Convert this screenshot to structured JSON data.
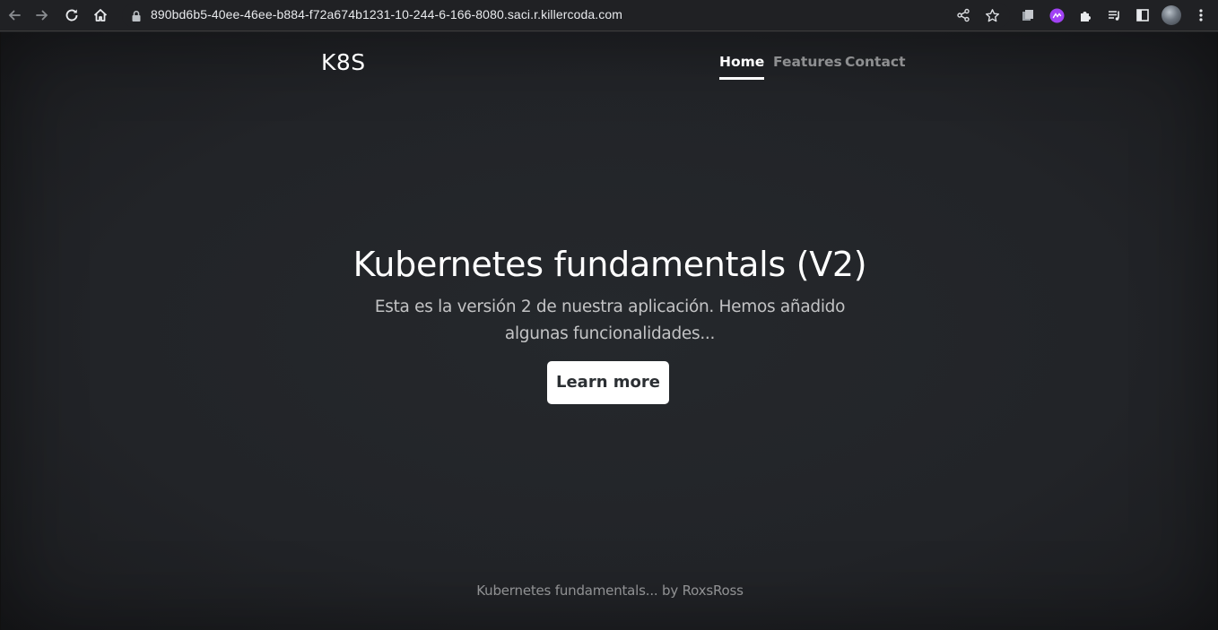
{
  "browser": {
    "url": "890bd6b5-40ee-46ee-b884-f72a674b1231-10-244-6-166-8080.saci.r.killercoda.com",
    "icons": [
      "back-icon",
      "forward-icon",
      "reload-icon",
      "home-icon",
      "lock-icon",
      "share-icon",
      "star-icon",
      "extension-copy-icon",
      "extension-purple-icon",
      "puzzle-icon",
      "media-icon",
      "side-panel-icon",
      "avatar",
      "menu-icon"
    ],
    "colors": {
      "toolbar_bg": "#202124",
      "text": "#e8eaed",
      "icon": "#dadce0",
      "purple_ext": "#a142f4"
    }
  },
  "header": {
    "brand": "K8S",
    "nav": [
      {
        "label": "Home",
        "active": true
      },
      {
        "label": "Features",
        "active": false
      },
      {
        "label": "Contact",
        "active": false
      }
    ]
  },
  "hero": {
    "title": "Kubernetes fundamentals (V2)",
    "lead": "Esta es la versión 2 de nuestra aplicación. Hemos añadido algunas funcionalidades...",
    "button_label": "Learn more"
  },
  "footer": {
    "text": "Kubernetes fundamentals... by RoxsRoss"
  },
  "colors": {
    "page_bg": "#212327",
    "button_bg": "#ffffff",
    "button_text": "#2b2f33"
  }
}
